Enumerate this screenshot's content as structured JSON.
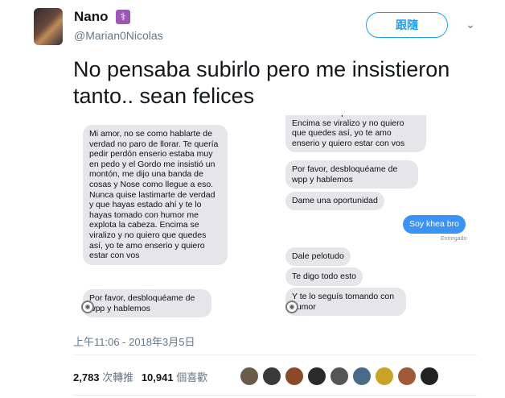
{
  "user": {
    "name": "Nano",
    "handle": "@Marian0Nicolas",
    "badge": "⚕"
  },
  "follow_label": "跟隨",
  "tweet_text": "No pensaba subirlo pero me insistieron tanto.. sean felices",
  "media": {
    "left": {
      "messages": [
        "Mi amor, no se como hablarte de verdad no paro de llorar. Te quería pedir perdón enserio estaba muy en pedo y el Gordo me insistió un montón, me dijo una banda de cosas y Nose como llegue a eso. Nunca quise lastimarte de verdad y que hayas estado ahí y te lo hayas tomado con humor me explota la cabeza. Encima se viralizo y no quiero que quedes así, yo te amo enserio y quiero estar con vos",
        "Por favor, desbloquéame de wpp y hablemos"
      ]
    },
    "right": {
      "top_partial": "humor me explota la cabeza.\nEncima se viralizo y no quiero que quedes así, yo te amo enserio y quiero estar con vos",
      "messages_in": [
        "Por favor, desbloquéame de wpp y hablemos",
        "Dame una oportunidad"
      ],
      "message_out": "Soy khea bro",
      "delivered": "Entregado",
      "messages_after": [
        "Dale pelotudo",
        "Te digo todo esto",
        "Y te lo seguís tomando con humor"
      ]
    }
  },
  "timestamp": "上午11:06 - 2018年3月5日",
  "stats": {
    "retweets_count": "2,783",
    "retweets_label": "次轉推",
    "likes_count": "10,941",
    "likes_label": "個喜歡"
  },
  "likers": [
    "#6b5b4b",
    "#3a3a3a",
    "#8a4a2a",
    "#2a2a2a",
    "#555555",
    "#4a6a8a",
    "#c9a227",
    "#a05a3a",
    "#222222"
  ]
}
